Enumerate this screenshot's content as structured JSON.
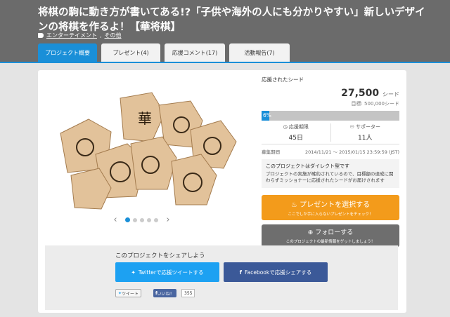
{
  "project": {
    "title": "将棋の駒に動き方が書いてある!?「子供や海外の人にも分かりやすい」新しいデザインの将棋を作るよ！【華将棋】",
    "categories": [
      "エンターテイメント",
      "その他"
    ],
    "category_separator": ","
  },
  "tabs": [
    {
      "label": "プロジェクト概要"
    },
    {
      "label": "プレゼント(4)"
    },
    {
      "label": "応援コメント(17)"
    },
    {
      "label": "活動報告(7)"
    }
  ],
  "photo": {
    "piece_text": "華"
  },
  "funding": {
    "label": "応援されたシード",
    "amount": "27,500",
    "amount_unit": "シード",
    "target": "目標: 500,000シード",
    "percent_text": "6%",
    "progress": 0.055,
    "remaining_label": "応援期限",
    "remaining_value": "45日",
    "supporters_label": "サポーター",
    "supporters_value": "11人",
    "period_label": "募集期間",
    "period_value": "2014/11/21 ～ 2015/01/15 23:59:59 (JST)"
  },
  "note": {
    "title": "このプロジェクトはダイレクト型です",
    "body": "プロジェクトの実施が確約されているので、目標額の達成に関わらずミッショナーに応援されたシードがお届けされます"
  },
  "actions": {
    "present_main": "プレゼントを選択する",
    "present_sub": "ここでしか手に入らないプレゼントをチェック！",
    "follow_main": "フォローする",
    "follow_sub": "このプロジェクトの最新情報をゲットしましょう！"
  },
  "share": {
    "title": "このプロジェクトをシェアしよう",
    "twitter": "Twitterで応援ツイートする",
    "facebook": "Facebookで応援シェアする",
    "tweet": "ツイート",
    "like": "いいね！",
    "like_count": "355"
  },
  "colors": {
    "accent": "#1a8fd8",
    "orange": "#f39b1b",
    "facebook": "#3b5998",
    "twitter": "#1da1f2"
  }
}
